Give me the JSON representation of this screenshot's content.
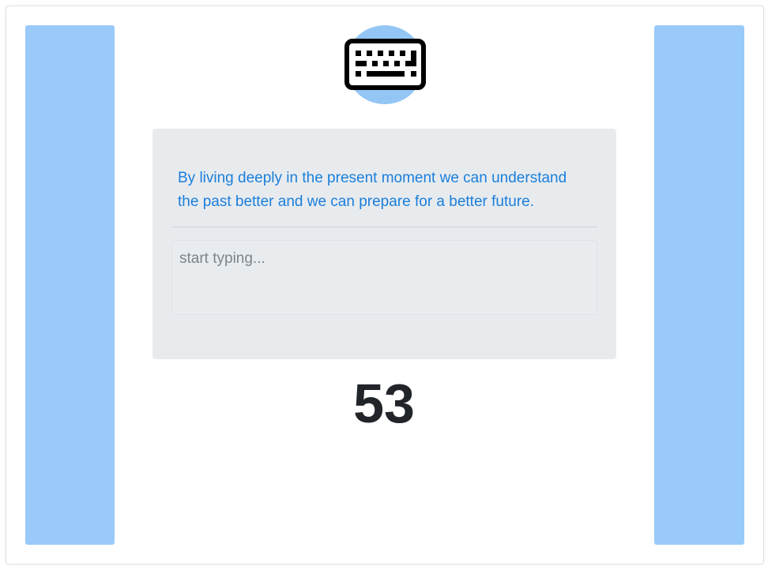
{
  "theme": {
    "side_panel_color": "#99caf9",
    "card_background": "#e8ebee",
    "quote_color": "#1a7fdb",
    "logo_circle_color": "#94c6f5"
  },
  "logo": {
    "icon": "keyboard-icon"
  },
  "quote": {
    "text": "By living deeply in the present moment we can understand the past better and we can prepare for a better future."
  },
  "typing": {
    "placeholder": "start typing...",
    "value": ""
  },
  "timer": {
    "value": "53"
  }
}
